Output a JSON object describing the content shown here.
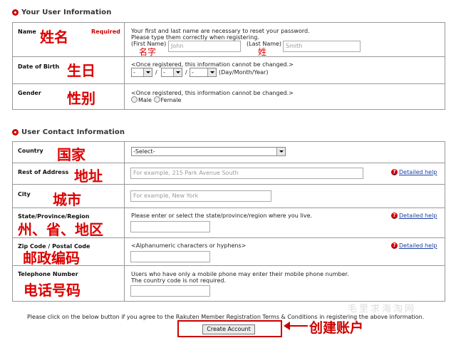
{
  "sections": {
    "user_info_title": "Your User Information",
    "contact_info_title": "User Contact Information"
  },
  "name": {
    "label": "Name",
    "annotation_cn": "姓名",
    "required": "Required",
    "desc1": "Your first and last name are necessary to reset your password.",
    "desc2": "Please type them correctly when registering.",
    "first_label": "(First Name)",
    "first_placeholder": "John",
    "first_cn": "名字",
    "last_label": "(Last Name)",
    "last_placeholder": "Smith",
    "last_cn": "姓"
  },
  "dob": {
    "label": "Date of Birth",
    "annotation_cn": "生日",
    "note": "<Once registered, this information cannot be changed.>",
    "day": "-",
    "month": "-",
    "year": "-",
    "sep": "/",
    "format": "(Day/Month/Year)"
  },
  "gender": {
    "label": "Gender",
    "annotation_cn": "性别",
    "note": "<Once registered, this information cannot be changed.>",
    "male": "Male",
    "female": "Female"
  },
  "country": {
    "label": "Country",
    "annotation_cn": "国家",
    "selected": "-Select-"
  },
  "address": {
    "label": "Rest of Address",
    "annotation_cn": "地址",
    "placeholder": "For example, 215 Park Avenue South",
    "help": "Detailed help"
  },
  "city": {
    "label": "City",
    "annotation_cn": "城市",
    "placeholder": "For example, New York"
  },
  "state": {
    "label": "State/Province/Region",
    "annotation_cn": "州、省、地区",
    "desc": "Please enter or select the state/province/region where you live.",
    "help": "Detailed help"
  },
  "zip": {
    "label": "Zip Code / Postal Code",
    "annotation_cn": "邮政编码",
    "desc": "<Alphanumeric characters or hyphens>",
    "help": "Detailed help"
  },
  "phone": {
    "label": "Telephone Number",
    "annotation_cn": "电话号码",
    "desc1": "Users who have only a mobile phone may enter their mobile phone number.",
    "desc2": "The country code is not required."
  },
  "footer": {
    "notice": "Please click on the below button if you agree to the Rakuten Member Registration Terms & Conditions in registering the above information.",
    "button": "Create Account",
    "button_cn": "创建账户",
    "watermark": "毛里求海淘网"
  },
  "colors": {
    "accent": "#cc0000",
    "link": "#1a3fa0"
  }
}
